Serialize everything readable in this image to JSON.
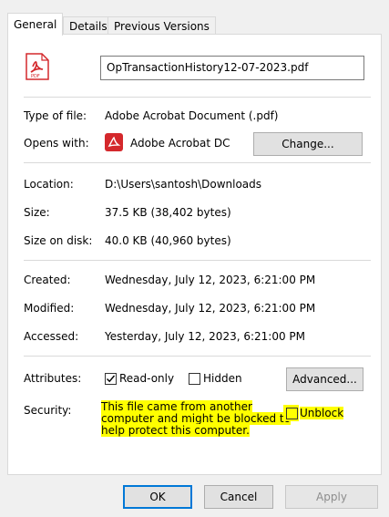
{
  "tabs": [
    "General",
    "Details",
    "Previous Versions"
  ],
  "file_name": "OpTransactionHistory12-07-2023.pdf",
  "file_icon_label": "PDF",
  "type_of_file": {
    "label": "Type of file:",
    "value": "Adobe Acrobat Document (.pdf)"
  },
  "opens_with": {
    "label": "Opens with:",
    "value": "Adobe Acrobat DC",
    "button": "Change..."
  },
  "location": {
    "label": "Location:",
    "value": "D:\\Users\\santosh\\Downloads"
  },
  "size": {
    "label": "Size:",
    "value": "37.5 KB (38,402 bytes)"
  },
  "size_on_disk": {
    "label": "Size on disk:",
    "value": "40.0 KB (40,960 bytes)"
  },
  "created": {
    "label": "Created:",
    "value": "Wednesday, July 12, 2023, 6:21:00 PM"
  },
  "modified": {
    "label": "Modified:",
    "value": "Wednesday, July 12, 2023, 6:21:00 PM"
  },
  "accessed": {
    "label": "Accessed:",
    "value": "Yesterday, July 12, 2023, 6:21:00 PM"
  },
  "attributes": {
    "label": "Attributes:",
    "readonly": "Read-only",
    "readonly_checked": true,
    "hidden": "Hidden",
    "hidden_checked": false,
    "advanced": "Advanced..."
  },
  "security": {
    "label": "Security:",
    "lines": [
      "This file came from another",
      "computer and might be blocked to",
      "help protect this computer."
    ],
    "unblock": "Unblock",
    "unblock_checked": false
  },
  "buttons": {
    "ok": "OK",
    "cancel": "Cancel",
    "apply": "Apply"
  },
  "colors": {
    "highlight": "#ffff00",
    "acrobat_red": "#d4282c",
    "focus_blue": "#0078d7"
  }
}
